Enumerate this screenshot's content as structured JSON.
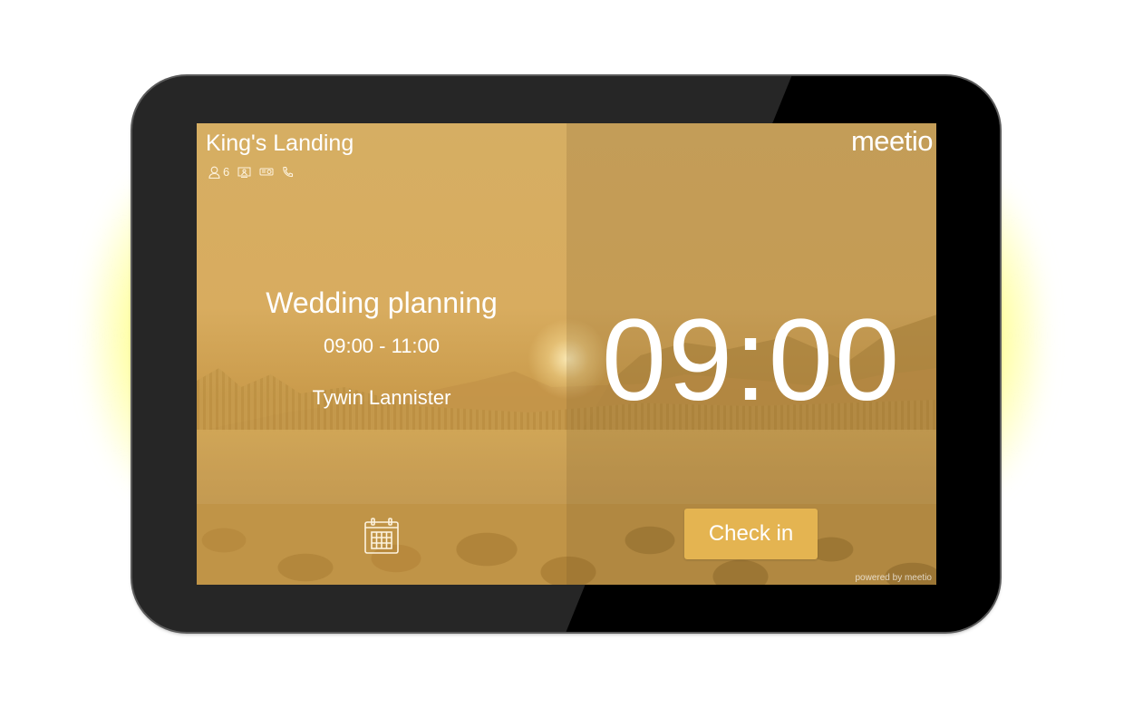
{
  "device": {
    "glow_color": "#ffff80",
    "bezel_color": "#262626"
  },
  "room": {
    "name": "King's Landing",
    "amenities": [
      {
        "icon": "person-icon",
        "label": "6"
      },
      {
        "icon": "display-icon",
        "label": ""
      },
      {
        "icon": "projector-icon",
        "label": ""
      },
      {
        "icon": "phone-icon",
        "label": ""
      }
    ]
  },
  "brand": {
    "logo": "meetio",
    "powered_by": "powered by meetio"
  },
  "meeting": {
    "title": "Wedding planning",
    "time_range": "09:00 - 11:00",
    "organizer": "Tywin Lannister"
  },
  "clock": {
    "time": "09:00"
  },
  "actions": {
    "check_in_label": "Check in",
    "calendar_icon": "calendar-icon",
    "accent_color": "#e4b451"
  }
}
